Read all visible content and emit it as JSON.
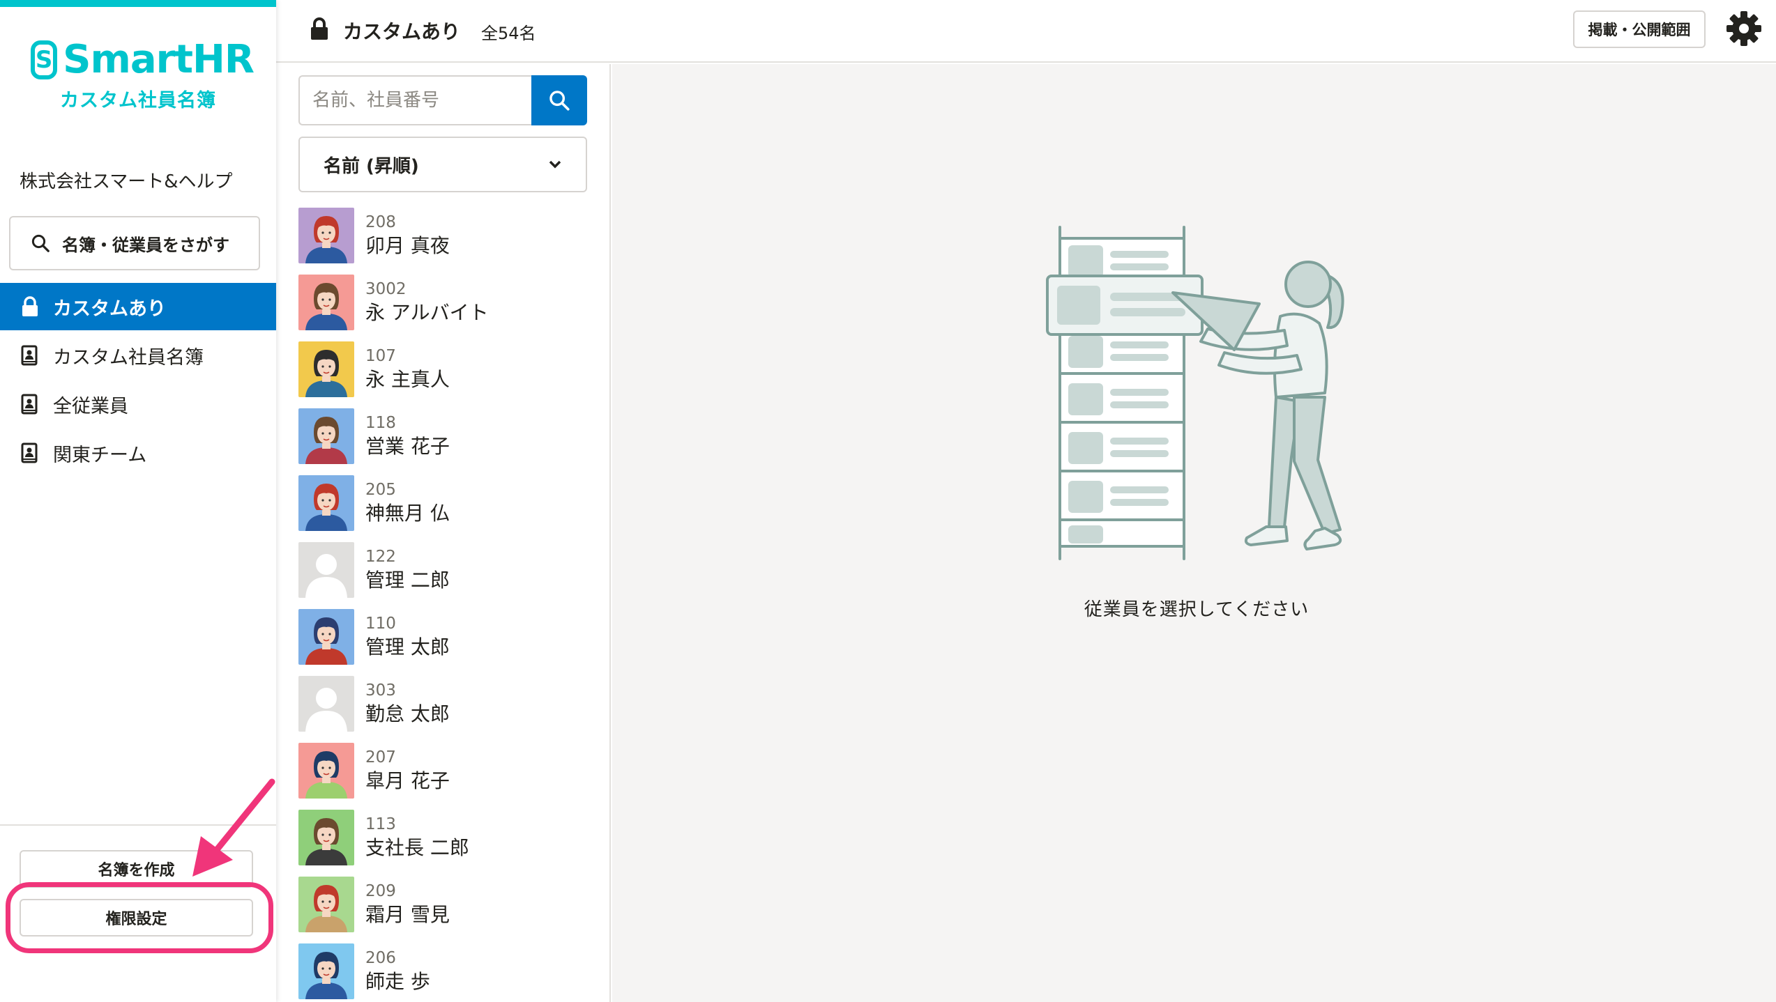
{
  "app": {
    "logo_mark": "S",
    "logo_text": "SmartHR",
    "logo_sub": "カスタム社員名簿",
    "brand_color": "#00c4cc",
    "accent_color": "#0077c7"
  },
  "sidebar": {
    "company": "株式会社スマート&ヘルプ",
    "search_button": "名簿・従業員をさがす",
    "items": [
      {
        "label": "カスタムあり",
        "icon": "lock-icon",
        "active": true
      },
      {
        "label": "カスタム社員名簿",
        "icon": "roster-book-icon",
        "active": false
      },
      {
        "label": "全従業員",
        "icon": "roster-book-icon",
        "active": false
      },
      {
        "label": "関東チーム",
        "icon": "roster-book-icon",
        "active": false
      }
    ],
    "create_button": "名簿を作成",
    "permission_button": "権限設定",
    "highlight_color": "#f0357a"
  },
  "header": {
    "title": "カスタムあり",
    "count": "全54名",
    "publish_button": "掲載・公開範囲",
    "settings_icon": "gear-icon"
  },
  "list": {
    "search_placeholder": "名前、社員番号",
    "sort_label": "名前 (昇順)",
    "employees": [
      {
        "number": "208",
        "name": "卯月 真夜",
        "avatar_bg": "#b79dd0",
        "hair": "#c0392b",
        "shirt": "#2c5aa0",
        "skin": "#f6d7c3"
      },
      {
        "number": "3002",
        "name": "永 アルバイト",
        "avatar_bg": "#f59a95",
        "hair": "#6b4a2f",
        "shirt": "#2c5aa0",
        "skin": "#f6d7c3"
      },
      {
        "number": "107",
        "name": "永 主真人",
        "avatar_bg": "#f2c94c",
        "hair": "#2d2d2d",
        "shirt": "#2c6e9b",
        "skin": "#f6d7c3"
      },
      {
        "number": "118",
        "name": "営業 花子",
        "avatar_bg": "#7fb0e6",
        "hair": "#6b4a2f",
        "shirt": "#b23a48",
        "skin": "#f6d7c3"
      },
      {
        "number": "205",
        "name": "神無月 仏",
        "avatar_bg": "#7fb0e6",
        "hair": "#c0392b",
        "shirt": "#2c5aa0",
        "skin": "#f6d7c3"
      },
      {
        "number": "122",
        "name": "管理 二郎",
        "avatar_bg": "#e0dfdd",
        "hair": "",
        "shirt": "",
        "skin": ""
      },
      {
        "number": "110",
        "name": "管理 太郎",
        "avatar_bg": "#7fb0e6",
        "hair": "#2c3e70",
        "shirt": "#c0392b",
        "skin": "#f6d7c3"
      },
      {
        "number": "303",
        "name": "勤怠 太郎",
        "avatar_bg": "#e0dfdd",
        "hair": "",
        "shirt": "",
        "skin": ""
      },
      {
        "number": "207",
        "name": "皐月 花子",
        "avatar_bg": "#f59a95",
        "hair": "#1f3b66",
        "shirt": "#9ccf6e",
        "skin": "#f6d7c3"
      },
      {
        "number": "113",
        "name": "支社長 二郎",
        "avatar_bg": "#8fcf7a",
        "hair": "#6b4a2f",
        "shirt": "#3b3b3b",
        "skin": "#f6d7c3"
      },
      {
        "number": "209",
        "name": "霜月 雪見",
        "avatar_bg": "#a8d88f",
        "hair": "#c0392b",
        "shirt": "#c9a26b",
        "skin": "#f6d7c3"
      },
      {
        "number": "206",
        "name": "師走 歩",
        "avatar_bg": "#7fc8ef",
        "hair": "#1f3b66",
        "shirt": "#2c5aa0",
        "skin": "#f6d7c3"
      }
    ]
  },
  "main": {
    "empty_message": "従業員を選択してください",
    "illustration": "employee-roster-illustration"
  }
}
